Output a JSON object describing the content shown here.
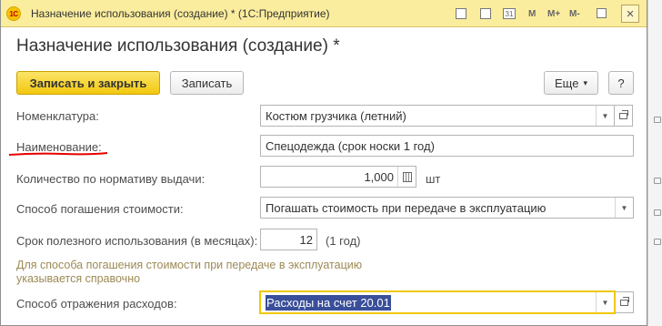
{
  "window": {
    "title": "Назначение использования (создание) * (1С:Предприятие)",
    "app_icon": "1С",
    "toolbar_icons": [
      "floppy-icon",
      "panel-icon",
      "calendar-icon",
      "m-icon",
      "m-plus-icon",
      "m-minus-icon",
      "restore-icon"
    ],
    "toolbar_labels": {
      "calendar": "31",
      "m": "M",
      "m_plus": "M+",
      "m_minus": "M-"
    },
    "close_glyph": "×"
  },
  "form": {
    "title": "Назначение использования (создание) *"
  },
  "toolbar": {
    "save_close_label": "Записать и закрыть",
    "save_label": "Записать",
    "more_label": "Еще",
    "more_arrow": "▾",
    "help_label": "?"
  },
  "fields": {
    "nomenclature": {
      "label": "Номенклатура:",
      "value": "Костюм грузчика (летний)"
    },
    "name": {
      "label": "Наименование:",
      "value": "Спецодежда (срок носки 1 год)"
    },
    "quantity": {
      "label": "Количество по нормативу выдачи:",
      "value": "1,000",
      "unit": "шт"
    },
    "repayment": {
      "label": "Способ погашения стоимости:",
      "value": "Погашать стоимость при передаче в эксплуатацию"
    },
    "useful_life": {
      "label": "Срок полезного использования (в месяцах):",
      "value": "12",
      "hint": "(1 год)"
    },
    "note": "Для способа погашения стоимости при передаче в эксплуатацию указывается справочно",
    "expense": {
      "label": "Способ отражения расходов:",
      "value": "Расходы на счет 20.01"
    }
  },
  "colors": {
    "titlebar": "#fbed9e",
    "primary_button": "#f2c80f",
    "note_text": "#9c8a55",
    "selection": "#3a4f9a",
    "annotation_red": "#e60000"
  }
}
